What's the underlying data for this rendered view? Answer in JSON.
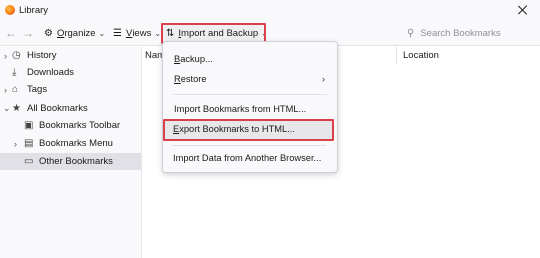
{
  "window": {
    "title": "Library"
  },
  "toolbar": {
    "back_icon": "back-arrow-icon",
    "forward_icon": "forward-arrow-icon",
    "organize": {
      "prefix": "",
      "underlined": "O",
      "rest": "rganize"
    },
    "views": {
      "underlined": "V",
      "rest": "iews"
    },
    "import_backup": {
      "underlined": "I",
      "rest": "mport and Backup"
    },
    "search_placeholder": "Search Bookmarks"
  },
  "sidebar": {
    "items": [
      {
        "label": "History",
        "icon": "clock-icon",
        "twisty": true
      },
      {
        "label": "Downloads",
        "icon": "download-icon",
        "twisty": false
      },
      {
        "label": "Tags",
        "icon": "tag-icon",
        "twisty": true
      },
      {
        "label": "All Bookmarks",
        "icon": "star-icon",
        "twisty": true
      },
      {
        "label": "Bookmarks Toolbar",
        "icon": "toolbar-icon",
        "twisty": false
      },
      {
        "label": "Bookmarks Menu",
        "icon": "menu-icon",
        "twisty": true
      },
      {
        "label": "Other Bookmarks",
        "icon": "folder-icon",
        "twisty": false,
        "selected": true
      }
    ]
  },
  "columns": {
    "name_partial": "Nam",
    "location": "Location"
  },
  "menu": {
    "backup": {
      "underlined": "B",
      "rest": "ackup..."
    },
    "restore": {
      "underlined": "R",
      "rest": "estore"
    },
    "import_html": "Import Bookmarks from HTML...",
    "export_html": {
      "underlined": "E",
      "rest": "xport Bookmarks to HTML..."
    },
    "import_browser": "Import Data from Another Browser..."
  },
  "accent_colors": {
    "highlight_border": "#d9404a"
  }
}
